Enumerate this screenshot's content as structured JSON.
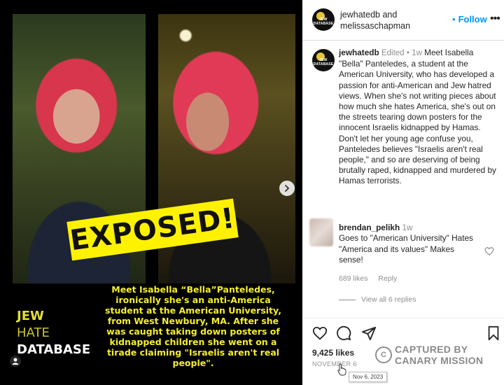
{
  "media": {
    "overlay_word": "EXPOSED!",
    "brand_lines": [
      "JEW",
      "HATE",
      "DATABASE"
    ],
    "caption": "Meet Isabella “Bella”Panteledes, ironically she's an anti-America student at the American University, from West Newbury, MA. After she was caught taking down posters of kidnapped children she went on a tirade claiming \"Israelis aren't real people\"."
  },
  "header": {
    "avatar_label": "JEW DATABASE",
    "user1": "jewhatedb",
    "and_word": "and",
    "user2": "melissaschapman",
    "follow_dot": "•",
    "follow_label": "Follow",
    "more": "•••"
  },
  "post_caption": {
    "avatar_label": "JEW DATABASE",
    "username": "jewhatedb",
    "edited": "Edited",
    "sep": "•",
    "time": "1w",
    "text": "Meet Isabella \"Bella\" Panteledes, a student at the American University, who has developed a passion for anti-American and Jew hatred views. When she's not writing pieces about how much she hates America, she's out on the streets tearing down posters for the innocent Israelis kidnapped by Hamas. Don't let her young age confuse you, Panteledes believes \"Israelis aren't real people,\" and so are deserving of being brutally raped, kidnapped and murdered by Hamas terrorists."
  },
  "comment": {
    "username": "brendan_pelikh",
    "time": "1w",
    "text": "Goes to \"American University\" Hates \"America and its values\" Makes sense!",
    "likes": "689 likes",
    "reply": "Reply"
  },
  "view_replies": "View all 6 replies",
  "actions": {
    "likes_count": "9,425 likes",
    "date": "NOVEMBER 6",
    "tooltip": "Nov 6, 2023"
  },
  "watermark": {
    "icon": "C",
    "line1": "CAPTURED BY",
    "line2": "CANARY MISSION"
  },
  "colors": {
    "accent": "#0095f6",
    "caption_yellow": "#f4ee2b",
    "banner_yellow": "#fff200"
  }
}
